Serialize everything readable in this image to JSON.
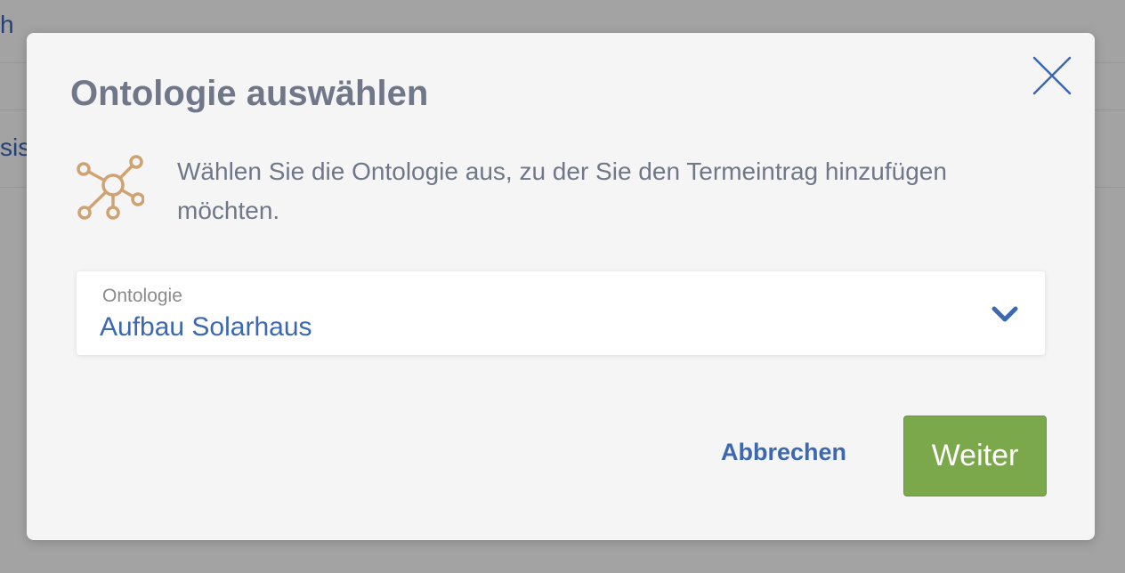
{
  "background": {
    "row1_text": "h",
    "row3_text": "sis"
  },
  "dialog": {
    "title": "Ontologie auswählen",
    "close_icon": "close-icon",
    "description_icon": "ontology-network-icon",
    "description": "Wählen Sie die Ontologie aus, zu der Sie den Termeintrag hinzufügen möchten.",
    "select": {
      "label": "Ontologie",
      "value": "Aufbau Solarhaus",
      "icon": "chevron-down-icon"
    },
    "buttons": {
      "cancel_label": "Abbrechen",
      "next_label": "Weiter"
    }
  },
  "colors": {
    "accent_blue": "#3c68b1",
    "icon_orange": "#cfa371",
    "primary_green": "#7ba84a",
    "title_gray": "#6f7789"
  }
}
